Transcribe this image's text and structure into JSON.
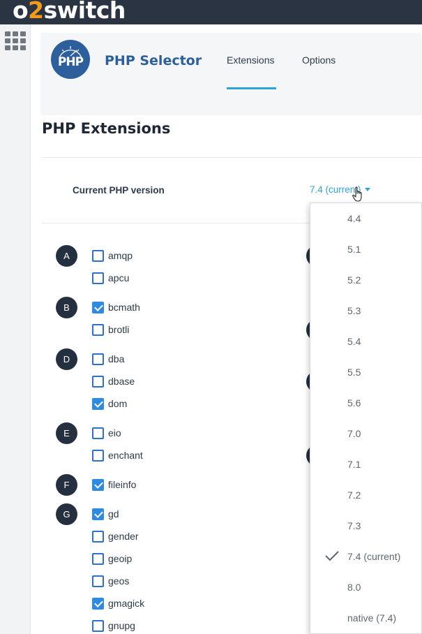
{
  "topbar": {
    "brand_prefix": "o",
    "brand_accent": "2",
    "brand_suffix": "switch",
    "brand_accent_color": "#f49b1b",
    "background": "#2a3443"
  },
  "sidebar": {
    "apps_icon": "grid-icon"
  },
  "header": {
    "logo_text": "PHP",
    "title": "PHP Selector",
    "tabs": [
      {
        "label": "Extensions",
        "active": true
      },
      {
        "label": "Options",
        "active": false
      }
    ]
  },
  "main": {
    "section_title": "PHP Extensions",
    "version_label": "Current PHP version",
    "version_value": "7.4 (current)"
  },
  "extensions": [
    {
      "letter": "A",
      "items": [
        {
          "name": "amqp",
          "checked": false
        },
        {
          "name": "apcu",
          "checked": false
        }
      ]
    },
    {
      "letter": "B",
      "items": [
        {
          "name": "bcmath",
          "checked": true
        },
        {
          "name": "brotli",
          "checked": false
        }
      ]
    },
    {
      "letter": "D",
      "items": [
        {
          "name": "dba",
          "checked": false
        },
        {
          "name": "dbase",
          "checked": false
        },
        {
          "name": "dom",
          "checked": true
        }
      ]
    },
    {
      "letter": "E",
      "items": [
        {
          "name": "eio",
          "checked": false
        },
        {
          "name": "enchant",
          "checked": false
        }
      ]
    },
    {
      "letter": "F",
      "items": [
        {
          "name": "fileinfo",
          "checked": true
        }
      ]
    },
    {
      "letter": "G",
      "items": [
        {
          "name": "gd",
          "checked": true
        },
        {
          "name": "gender",
          "checked": false
        },
        {
          "name": "geoip",
          "checked": false
        },
        {
          "name": "geos",
          "checked": false
        },
        {
          "name": "gmagick",
          "checked": true
        },
        {
          "name": "gnupg",
          "checked": false
        }
      ]
    }
  ],
  "version_menu": {
    "options": [
      {
        "label": "4.4",
        "selected": false
      },
      {
        "label": "5.1",
        "selected": false
      },
      {
        "label": "5.2",
        "selected": false
      },
      {
        "label": "5.3",
        "selected": false
      },
      {
        "label": "5.4",
        "selected": false
      },
      {
        "label": "5.5",
        "selected": false
      },
      {
        "label": "5.6",
        "selected": false
      },
      {
        "label": "7.0",
        "selected": false
      },
      {
        "label": "7.1",
        "selected": false
      },
      {
        "label": "7.2",
        "selected": false
      },
      {
        "label": "7.3",
        "selected": false
      },
      {
        "label": "7.4 (current)",
        "selected": true
      },
      {
        "label": "8.0",
        "selected": false
      },
      {
        "label": "native (7.4)",
        "selected": false
      }
    ]
  },
  "colors": {
    "accent": "#2ea3d9",
    "brand_blue": "#2c5f9c",
    "checkbox": "#2f8be0",
    "badge": "#24303f"
  }
}
